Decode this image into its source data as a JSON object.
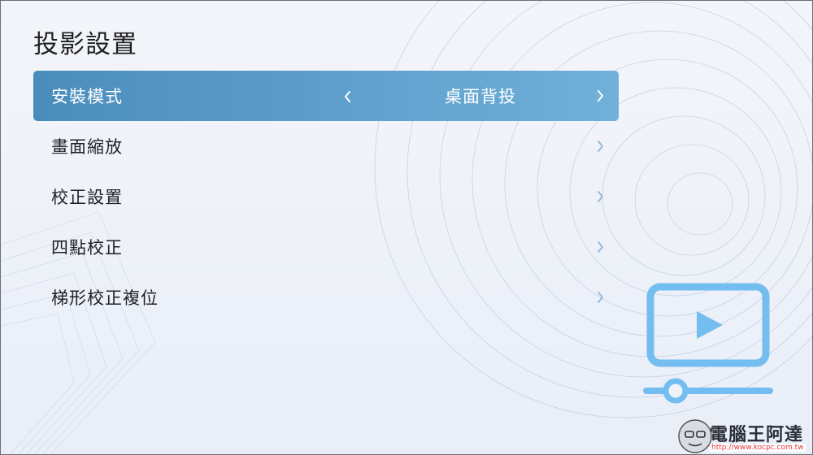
{
  "page": {
    "title": "投影設置"
  },
  "menu": {
    "items": [
      {
        "label": "安裝模式",
        "value": "桌面背投",
        "selected": true
      },
      {
        "label": "畫面縮放"
      },
      {
        "label": "校正設置"
      },
      {
        "label": "四點校正"
      },
      {
        "label": "梯形校正複位"
      }
    ]
  },
  "icons": {
    "row_arrow": "chevron-right-icon",
    "prev_value": "chevron-left-icon",
    "illustration": "projector-play-icon"
  },
  "watermark": {
    "text": "電腦王阿達",
    "url": "http://www.kocpc.com.tw"
  },
  "colors": {
    "selected_row": "#5796c5",
    "icon_blue": "#6fb9ec",
    "background": "#eef2f9"
  }
}
